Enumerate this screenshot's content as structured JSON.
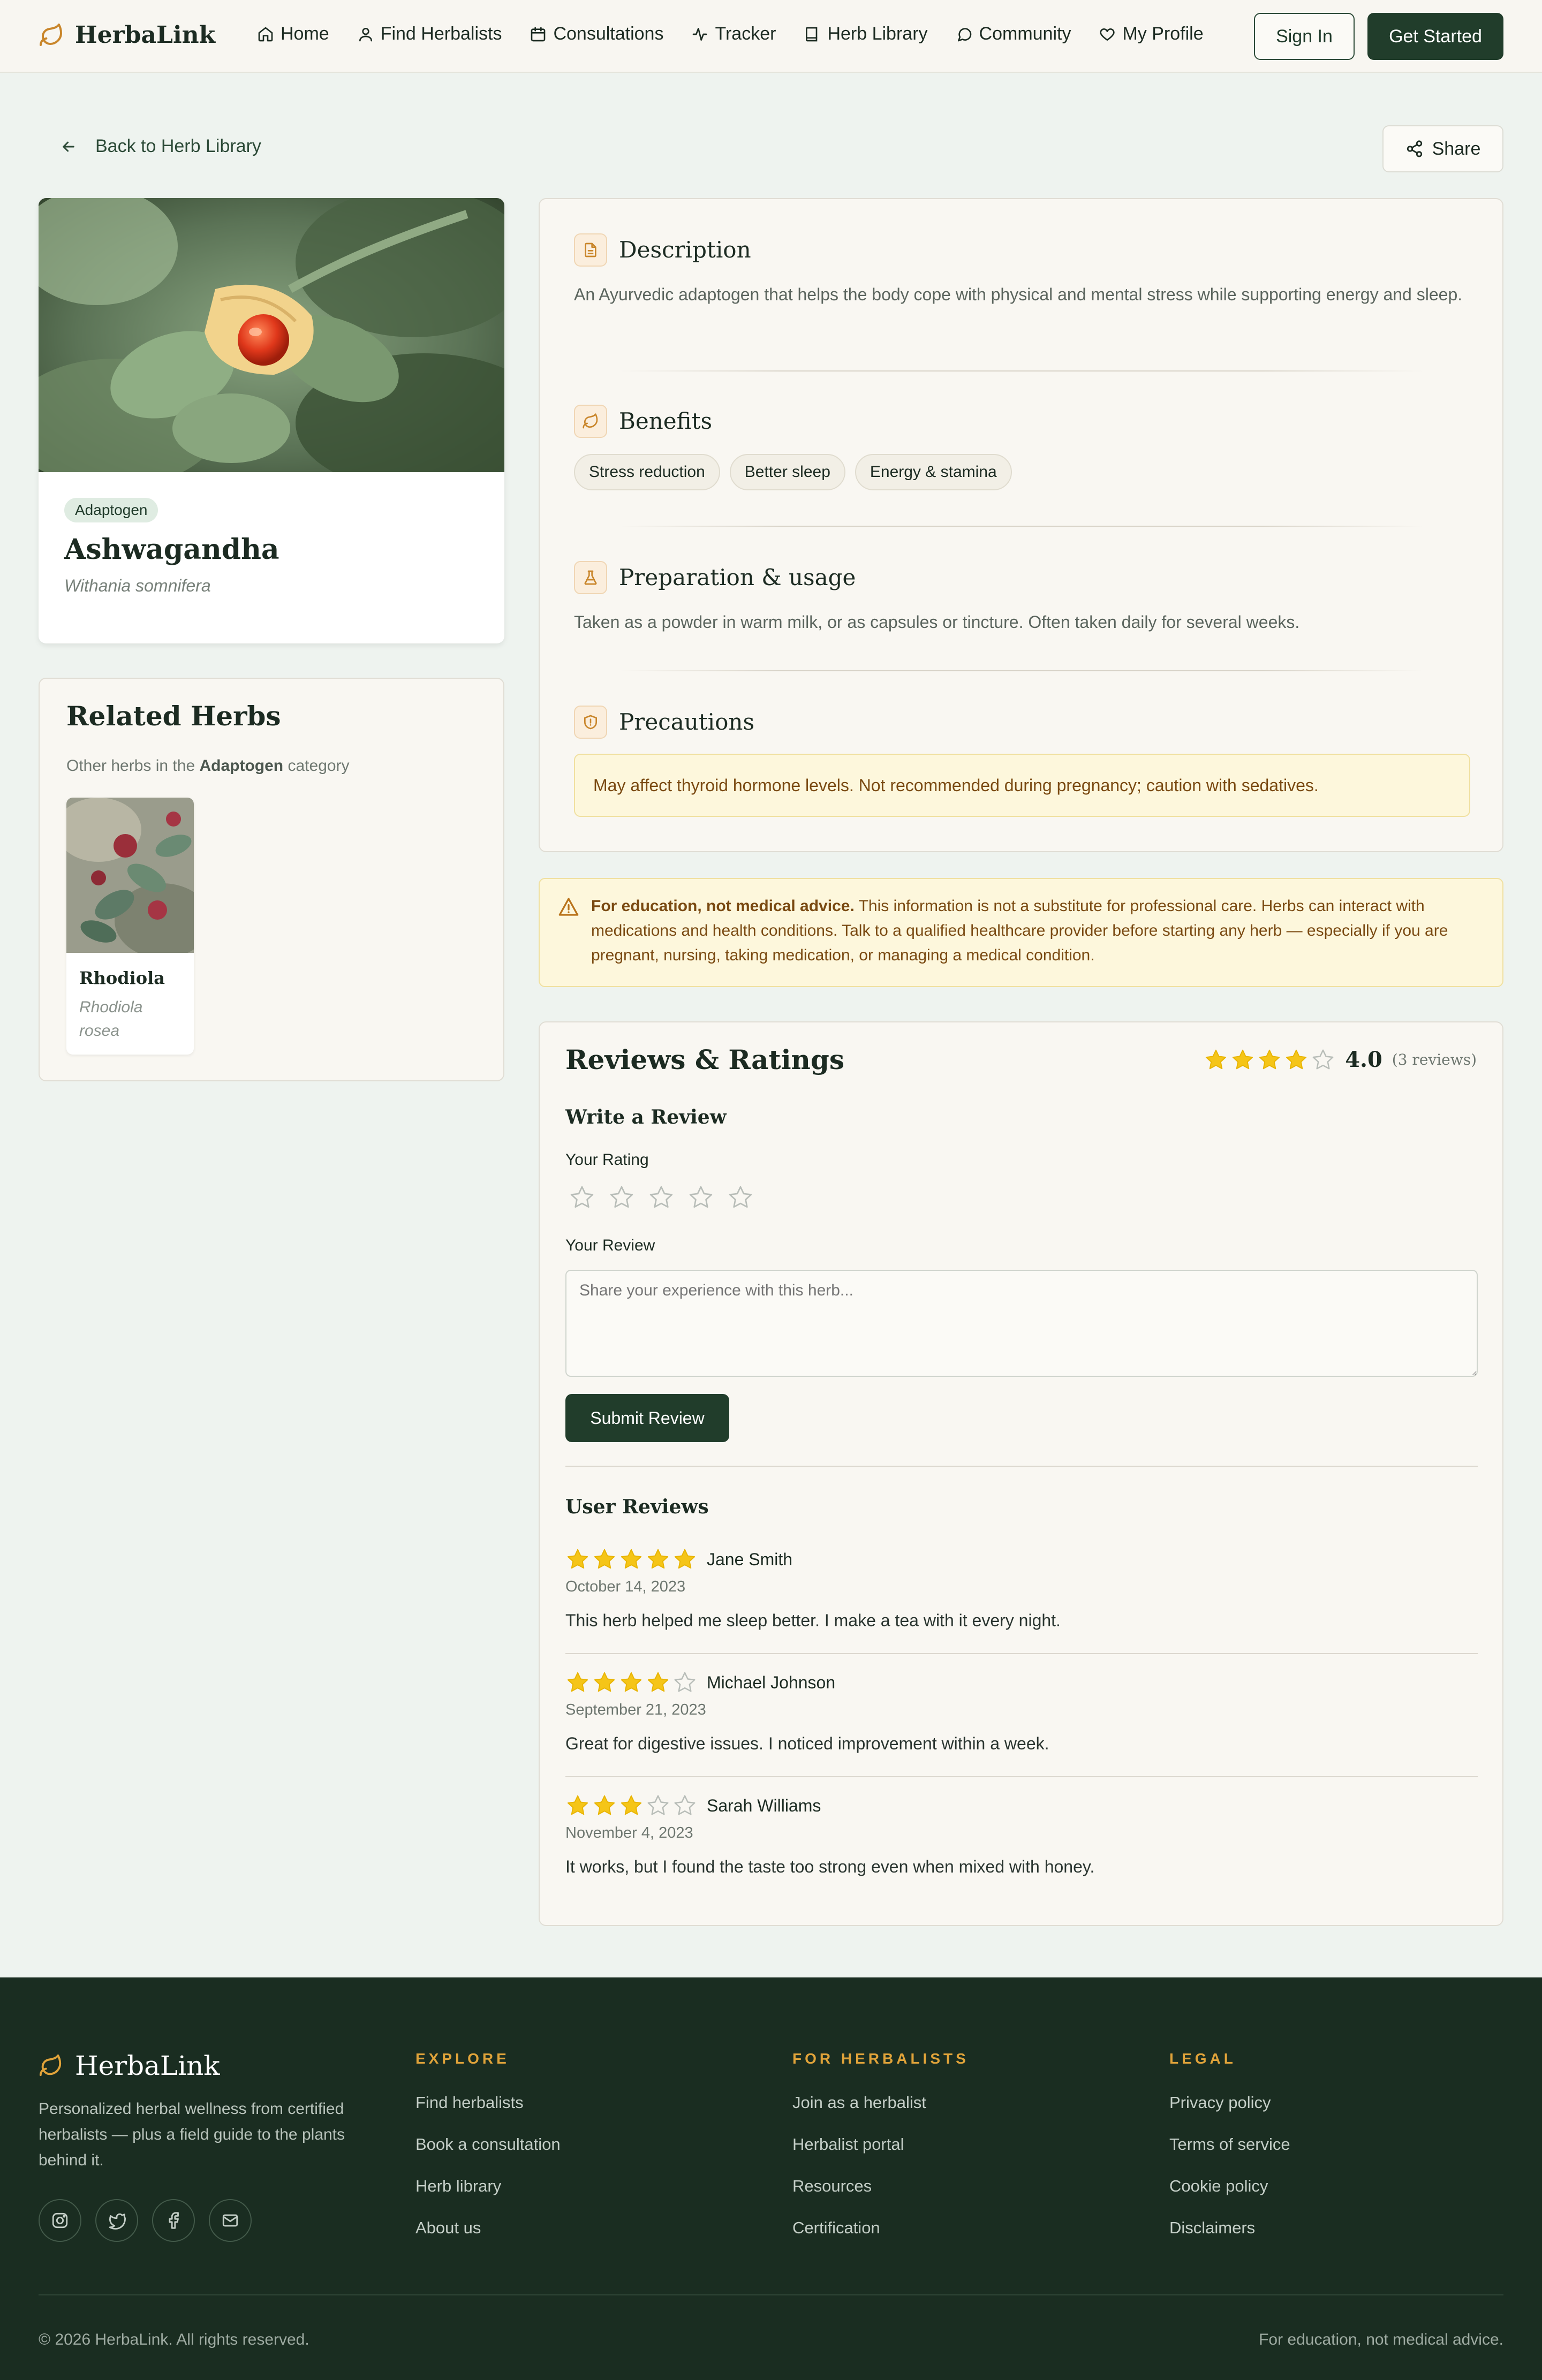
{
  "brand": {
    "name": "HerbaLink",
    "accent": "#c9862b",
    "dark_green": "#213d2b"
  },
  "nav": {
    "links": [
      {
        "label": "Home",
        "icon": "home-icon"
      },
      {
        "label": "Find Herbalists",
        "icon": "user-icon"
      },
      {
        "label": "Consultations",
        "icon": "calendar-icon"
      },
      {
        "label": "Tracker",
        "icon": "activity-icon"
      },
      {
        "label": "Herb Library",
        "icon": "book-icon"
      },
      {
        "label": "Community",
        "icon": "chat-icon"
      },
      {
        "label": "My Profile",
        "icon": "heart-icon"
      }
    ],
    "sign_in": "Sign In",
    "get_started": "Get Started"
  },
  "back_label": "Back to Herb Library",
  "share_label": "Share",
  "herb": {
    "category": "Adaptogen",
    "name": "Ashwagandha",
    "latin": "Withania somnifera"
  },
  "related": {
    "title": "Related Herbs",
    "subtitle_prefix": "Other herbs in the",
    "subtitle_category": "Adaptogen",
    "subtitle_suffix": "category",
    "items": [
      {
        "name": "Rhodiola",
        "latin": "Rhodiola rosea"
      }
    ]
  },
  "sections": {
    "description": {
      "title": "Description",
      "text": "An Ayurvedic adaptogen that helps the body cope with physical and mental stress while supporting energy and sleep."
    },
    "benefits": {
      "title": "Benefits",
      "chips": [
        "Stress reduction",
        "Better sleep",
        "Energy & stamina"
      ]
    },
    "preparation": {
      "title": "Preparation & usage",
      "text": "Taken as a powder in warm milk, or as capsules or tincture. Often taken daily for several weeks."
    },
    "precautions": {
      "title": "Precautions",
      "text": "May affect thyroid hormone levels. Not recommended during pregnancy; caution with sedatives."
    }
  },
  "disclaimer": {
    "bold": "For education, not medical advice.",
    "text": " This information is not a substitute for professional care. Herbs can interact with medications and health conditions. Talk to a qualified healthcare provider before starting any herb — especially if you are pregnant, nursing, taking medication, or managing a medical condition."
  },
  "reviews": {
    "title": "Reviews & Ratings",
    "average": "4.0",
    "average_value": 4,
    "count_label": "(3 reviews)",
    "write_title": "Write a Review",
    "rating_label": "Your Rating",
    "review_label": "Your Review",
    "placeholder": "Share your experience with this herb...",
    "submit": "Submit Review",
    "user_reviews_title": "User Reviews",
    "items": [
      {
        "rating": 5,
        "author": "Jane Smith",
        "date": "October 14, 2023",
        "text": "This herb helped me sleep better. I make a tea with it every night."
      },
      {
        "rating": 4,
        "author": "Michael Johnson",
        "date": "September 21, 2023",
        "text": "Great for digestive issues. I noticed improvement within a week."
      },
      {
        "rating": 3,
        "author": "Sarah Williams",
        "date": "November 4, 2023",
        "text": "It works, but I found the taste too strong even when mixed with honey."
      }
    ]
  },
  "footer": {
    "brand": "HerbaLink",
    "description": "Personalized herbal wellness from certified herbalists — plus a field guide to the plants behind it.",
    "socials": [
      "instagram-icon",
      "twitter-icon",
      "facebook-icon",
      "mail-icon"
    ],
    "columns": [
      {
        "title": "EXPLORE",
        "links": [
          "Find herbalists",
          "Book a consultation",
          "Herb library",
          "About us"
        ]
      },
      {
        "title": "FOR HERBALISTS",
        "links": [
          "Join as a herbalist",
          "Herbalist portal",
          "Resources",
          "Certification"
        ]
      },
      {
        "title": "LEGAL",
        "links": [
          "Privacy policy",
          "Terms of service",
          "Cookie policy",
          "Disclaimers"
        ]
      }
    ],
    "copyright": "© 2026 HerbaLink. All rights reserved.",
    "note": "For education, not medical advice."
  }
}
